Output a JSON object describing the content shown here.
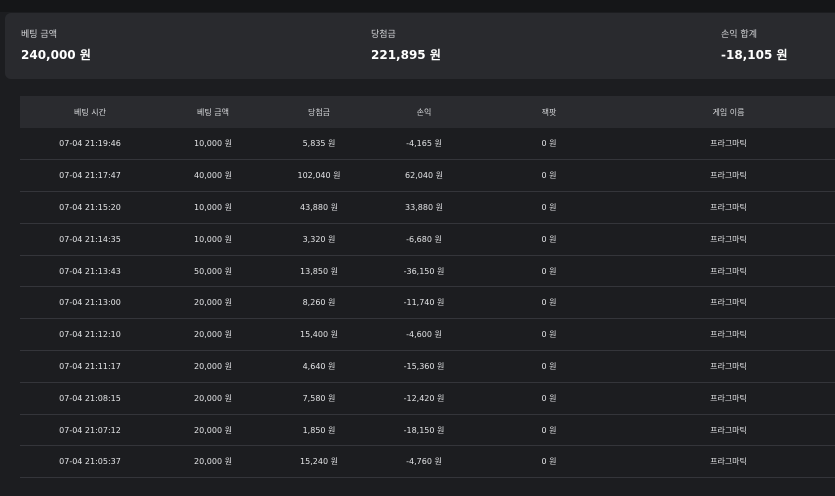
{
  "summary": {
    "bet_amount_label": "베팅 금액",
    "bet_amount_value": "240,000 원",
    "winnings_label": "당첨금",
    "winnings_value": "221,895 원",
    "profit_label": "손익 합계",
    "profit_value": "-18,105 원"
  },
  "table": {
    "headers": [
      "베팅 시간",
      "베팅 금액",
      "당첨금",
      "손익",
      "잭팟",
      "게임 이름"
    ],
    "rows": [
      [
        "07-04 21:19:46",
        "10,000 원",
        "5,835 원",
        "-4,165 원",
        "0 원",
        "프라그마틱"
      ],
      [
        "07-04 21:17:47",
        "40,000 원",
        "102,040 원",
        "62,040 원",
        "0 원",
        "프라그마틱"
      ],
      [
        "07-04 21:15:20",
        "10,000 원",
        "43,880 원",
        "33,880 원",
        "0 원",
        "프라그마틱"
      ],
      [
        "07-04 21:14:35",
        "10,000 원",
        "3,320 원",
        "-6,680 원",
        "0 원",
        "프라그마틱"
      ],
      [
        "07-04 21:13:43",
        "50,000 원",
        "13,850 원",
        "-36,150 원",
        "0 원",
        "프라그마틱"
      ],
      [
        "07-04 21:13:00",
        "20,000 원",
        "8,260 원",
        "-11,740 원",
        "0 원",
        "프라그마틱"
      ],
      [
        "07-04 21:12:10",
        "20,000 원",
        "15,400 원",
        "-4,600 원",
        "0 원",
        "프라그마틱"
      ],
      [
        "07-04 21:11:17",
        "20,000 원",
        "4,640 원",
        "-15,360 원",
        "0 원",
        "프라그마틱"
      ],
      [
        "07-04 21:08:15",
        "20,000 원",
        "7,580 원",
        "-12,420 원",
        "0 원",
        "프라그마틱"
      ],
      [
        "07-04 21:07:12",
        "20,000 원",
        "1,850 원",
        "-18,150 원",
        "0 원",
        "프라그마틱"
      ],
      [
        "07-04 21:05:37",
        "20,000 원",
        "15,240 원",
        "-4,760 원",
        "0 원",
        "프라그마틱"
      ]
    ]
  }
}
